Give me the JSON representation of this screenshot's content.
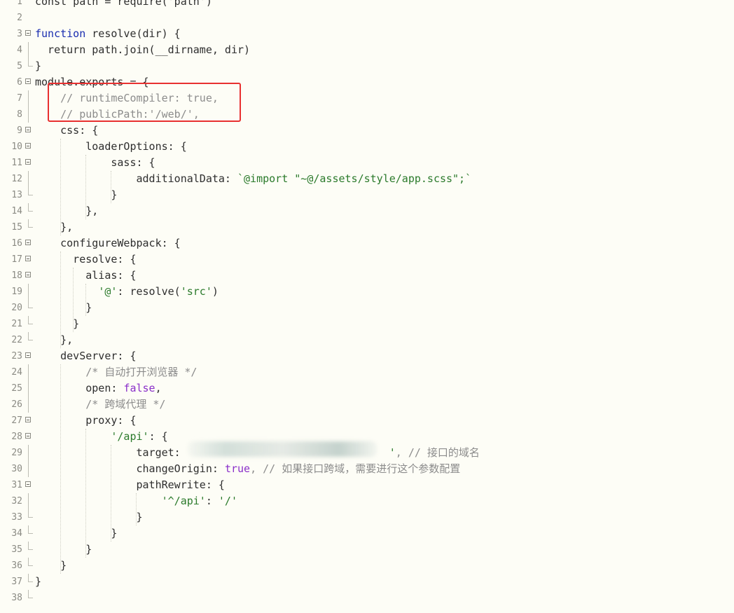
{
  "editor": {
    "language": "javascript",
    "highlight_color": "#e83030",
    "obscured_region": "line 29 target value blurred",
    "lines": [
      {
        "n": "1",
        "fold": "none",
        "tokens": [
          {
            "t": "const path = require('path')",
            "c": "plain"
          }
        ]
      },
      {
        "n": "2",
        "fold": "none",
        "tokens": []
      },
      {
        "n": "3",
        "fold": "open",
        "tokens": [
          {
            "t": "function",
            "c": "kw"
          },
          {
            "t": " resolve(dir) {",
            "c": "plain"
          }
        ]
      },
      {
        "n": "4",
        "fold": "line",
        "tokens": [
          {
            "t": "  return path.join(__dirname, dir)",
            "c": "plain"
          }
        ]
      },
      {
        "n": "5",
        "fold": "end",
        "tokens": [
          {
            "t": "}",
            "c": "plain"
          }
        ]
      },
      {
        "n": "6",
        "fold": "open",
        "tokens": [
          {
            "t": "module.exports = {",
            "c": "plain"
          }
        ]
      },
      {
        "n": "7",
        "fold": "line",
        "tokens": [
          {
            "t": "    // runtimeCompiler: true,",
            "c": "cmt"
          }
        ]
      },
      {
        "n": "8",
        "fold": "line",
        "tokens": [
          {
            "t": "    // publicPath:'/web/',",
            "c": "cmt"
          }
        ]
      },
      {
        "n": "9",
        "fold": "open",
        "tokens": [
          {
            "t": "    css: {",
            "c": "plain"
          }
        ]
      },
      {
        "n": "10",
        "fold": "open",
        "tokens": [
          {
            "t": "        loaderOptions: {",
            "c": "plain"
          }
        ]
      },
      {
        "n": "11",
        "fold": "open",
        "tokens": [
          {
            "t": "            sass: {",
            "c": "plain"
          }
        ]
      },
      {
        "n": "12",
        "fold": "line",
        "tokens": [
          {
            "t": "                additionalData: ",
            "c": "plain"
          },
          {
            "t": "`@import \"~@/assets/style/app.scss\";`",
            "c": "str"
          }
        ]
      },
      {
        "n": "13",
        "fold": "end",
        "tokens": [
          {
            "t": "            }",
            "c": "plain"
          }
        ]
      },
      {
        "n": "14",
        "fold": "end",
        "tokens": [
          {
            "t": "        },",
            "c": "plain"
          }
        ]
      },
      {
        "n": "15",
        "fold": "end",
        "tokens": [
          {
            "t": "    },",
            "c": "plain"
          }
        ]
      },
      {
        "n": "16",
        "fold": "open",
        "tokens": [
          {
            "t": "    configureWebpack: {",
            "c": "plain"
          }
        ]
      },
      {
        "n": "17",
        "fold": "open",
        "tokens": [
          {
            "t": "      resolve: {",
            "c": "plain"
          }
        ]
      },
      {
        "n": "18",
        "fold": "open",
        "tokens": [
          {
            "t": "        alias: {",
            "c": "plain"
          }
        ]
      },
      {
        "n": "19",
        "fold": "line",
        "tokens": [
          {
            "t": "          ",
            "c": "plain"
          },
          {
            "t": "'@'",
            "c": "str"
          },
          {
            "t": ": resolve(",
            "c": "plain"
          },
          {
            "t": "'src'",
            "c": "str"
          },
          {
            "t": ")",
            "c": "plain"
          }
        ]
      },
      {
        "n": "20",
        "fold": "end",
        "tokens": [
          {
            "t": "        }",
            "c": "plain"
          }
        ]
      },
      {
        "n": "21",
        "fold": "end",
        "tokens": [
          {
            "t": "      }",
            "c": "plain"
          }
        ]
      },
      {
        "n": "22",
        "fold": "end",
        "tokens": [
          {
            "t": "    },",
            "c": "plain"
          }
        ]
      },
      {
        "n": "23",
        "fold": "open",
        "tokens": [
          {
            "t": "    devServer: {",
            "c": "plain"
          }
        ]
      },
      {
        "n": "24",
        "fold": "line",
        "tokens": [
          {
            "t": "        /* 自动打开浏览器 */",
            "c": "cmt"
          }
        ]
      },
      {
        "n": "25",
        "fold": "line",
        "tokens": [
          {
            "t": "        open: ",
            "c": "plain"
          },
          {
            "t": "false",
            "c": "bool"
          },
          {
            "t": ",",
            "c": "plain"
          }
        ]
      },
      {
        "n": "26",
        "fold": "line",
        "tokens": [
          {
            "t": "        /* 跨域代理 */",
            "c": "cmt"
          }
        ]
      },
      {
        "n": "27",
        "fold": "open",
        "tokens": [
          {
            "t": "        proxy: {",
            "c": "plain"
          }
        ]
      },
      {
        "n": "28",
        "fold": "open",
        "tokens": [
          {
            "t": "            ",
            "c": "plain"
          },
          {
            "t": "'/api'",
            "c": "str"
          },
          {
            "t": ": {",
            "c": "plain"
          }
        ]
      },
      {
        "n": "29",
        "fold": "line",
        "tokens": [
          {
            "t": "                target: ",
            "c": "plain"
          },
          {
            "t": "                                ",
            "c": "plain"
          },
          {
            "t": "'",
            "c": "str"
          },
          {
            "t": ", // 接口的域名",
            "c": "cmt"
          }
        ]
      },
      {
        "n": "30",
        "fold": "line",
        "tokens": [
          {
            "t": "                changeOrigin: ",
            "c": "plain"
          },
          {
            "t": "true",
            "c": "bool"
          },
          {
            "t": ", // 如果接口跨域，需要进行这个参数配置",
            "c": "cmt"
          }
        ]
      },
      {
        "n": "31",
        "fold": "open",
        "tokens": [
          {
            "t": "                pathRewrite: {",
            "c": "plain"
          }
        ]
      },
      {
        "n": "32",
        "fold": "line",
        "tokens": [
          {
            "t": "                    ",
            "c": "plain"
          },
          {
            "t": "'^/api'",
            "c": "str"
          },
          {
            "t": ": ",
            "c": "plain"
          },
          {
            "t": "'/'",
            "c": "str"
          }
        ]
      },
      {
        "n": "33",
        "fold": "end",
        "tokens": [
          {
            "t": "                }",
            "c": "plain"
          }
        ]
      },
      {
        "n": "34",
        "fold": "end",
        "tokens": [
          {
            "t": "            }",
            "c": "plain"
          }
        ]
      },
      {
        "n": "35",
        "fold": "end",
        "tokens": [
          {
            "t": "        }",
            "c": "plain"
          }
        ]
      },
      {
        "n": "36",
        "fold": "end",
        "tokens": [
          {
            "t": "    }",
            "c": "plain"
          }
        ]
      },
      {
        "n": "37",
        "fold": "end",
        "tokens": [
          {
            "t": "}",
            "c": "plain"
          }
        ]
      },
      {
        "n": "38",
        "fold": "end",
        "tokens": []
      }
    ]
  }
}
